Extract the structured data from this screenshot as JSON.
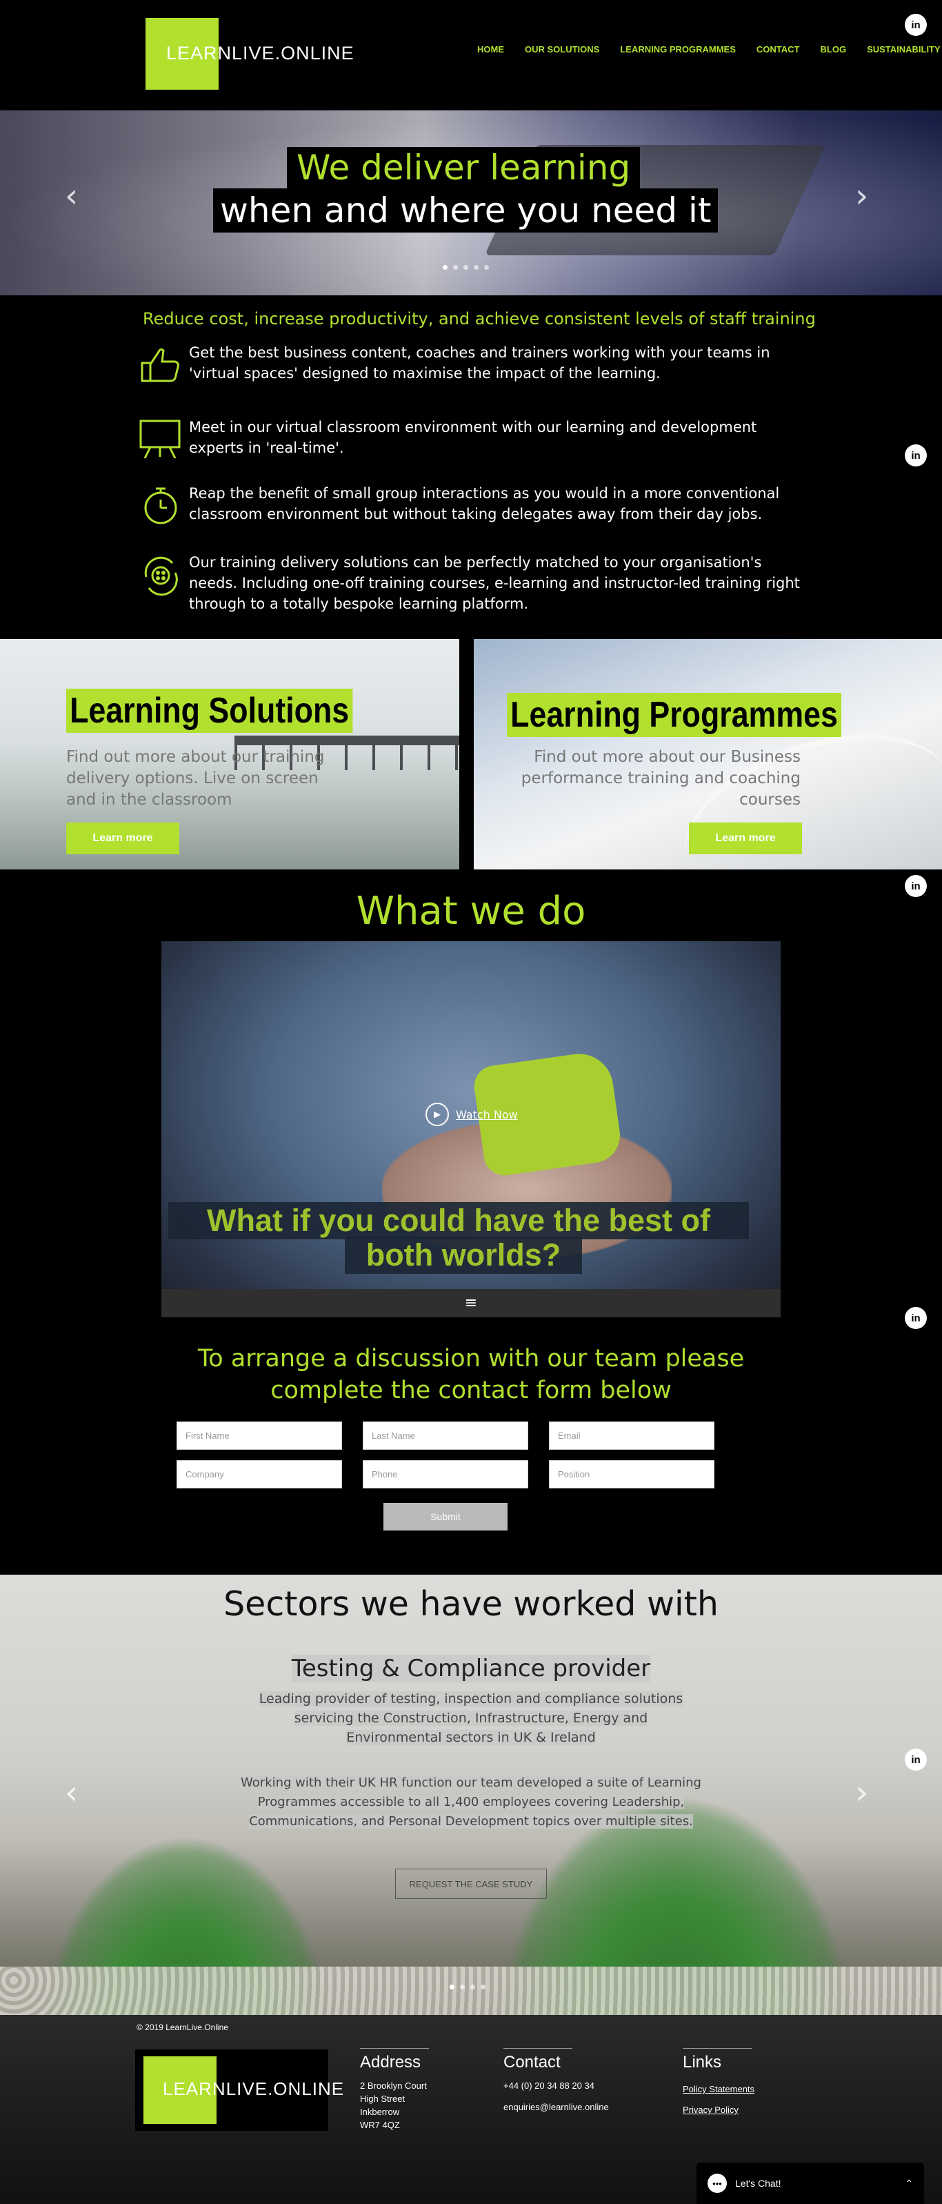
{
  "brand": {
    "logo_left": "LEARN",
    "logo_right": "LIVE.ONLINE"
  },
  "nav": {
    "items": [
      {
        "label": "HOME"
      },
      {
        "label": "OUR SOLUTIONS"
      },
      {
        "label": "LEARNING PROGRAMMES"
      },
      {
        "label": "CONTACT"
      },
      {
        "label": "BLOG"
      },
      {
        "label": "SUSTAINABILITY"
      }
    ]
  },
  "social": {
    "linkedin_glyph": "in",
    "icon": "linkedin-icon"
  },
  "hero": {
    "line1": "We deliver learning",
    "line2": "when and where you need it",
    "prev": "‹",
    "next": "›",
    "slides": 5
  },
  "features": {
    "heading": "Reduce cost, increase productivity, and achieve consistent levels of staff training",
    "items": [
      {
        "icon": "thumbs-up-icon",
        "text": "Get the best business content, coaches and trainers working with your teams in 'virtual spaces' designed to maximise the impact of the learning."
      },
      {
        "icon": "presentation-board-icon",
        "text": "Meet in our virtual classroom environment with our learning and development experts in 'real-time'."
      },
      {
        "icon": "stopwatch-icon",
        "text": "Reap the benefit of small group interactions as you would in a more conventional classroom environment but without taking delegates away from their day jobs."
      },
      {
        "icon": "target-cycle-icon",
        "text": "Our training delivery solutions can be perfectly matched to your organisation's needs. Including one-off training courses, e-learning and instructor-led training right through to a totally bespoke learning platform."
      }
    ]
  },
  "cards": {
    "solutions": {
      "title": "Learning Solutions",
      "text": "Find out more about our training delivery options. Live on screen and in the classroom",
      "button": "Learn more"
    },
    "programmes": {
      "title": "Learning Programmes",
      "text": "Find out more about our Business performance training and coaching courses",
      "button": "Learn more"
    }
  },
  "what_we_do": {
    "heading": "What we do",
    "watch": "Watch Now",
    "caption_line1": "What if you could have the best of",
    "caption_line2": "both worlds?",
    "menu_glyph": "≡"
  },
  "contact": {
    "heading_line1": "To arrange a discussion with our team please",
    "heading_line2": "complete the contact form below",
    "fields": {
      "first_name": "First Name",
      "last_name": "Last Name",
      "email": "Email",
      "company": "Company",
      "phone": "Phone",
      "position": "Position"
    },
    "submit": "Submit"
  },
  "sectors": {
    "heading": "Sectors we have worked with",
    "subheading": "Testing & Compliance provider",
    "para1_lines": [
      "Leading provider of testing, inspection and compliance solutions",
      "servicing the Construction, Infrastructure, Energy and",
      "Environmental sectors in UK & Ireland"
    ],
    "para2_lines": [
      "Working with their UK HR function our team developed a suite of Learning",
      "Programmes accessible to all 1,400 employees covering Leadership,",
      "Communications, and Personal Development topics over multiple sites."
    ],
    "button": "REQUEST THE CASE STUDY",
    "slides": 4
  },
  "footer": {
    "copyright": "© 2019 LearnLive.Online",
    "address": {
      "title": "Address",
      "lines": [
        "2 Brooklyn Court",
        "High Street",
        "Inkberrow",
        "WR7 4QZ"
      ]
    },
    "contact": {
      "title": "Contact",
      "phone": "+44 (0) 20 34 88 20 34",
      "email": "enquiries@learnlive.online"
    },
    "links": {
      "title": "Links",
      "items": [
        "Policy Statements",
        "Privacy Policy"
      ]
    }
  },
  "chat": {
    "label": "Let's Chat!",
    "chevron": "⌃"
  },
  "colors": {
    "accent": "#b1e02e",
    "background": "#000000"
  }
}
